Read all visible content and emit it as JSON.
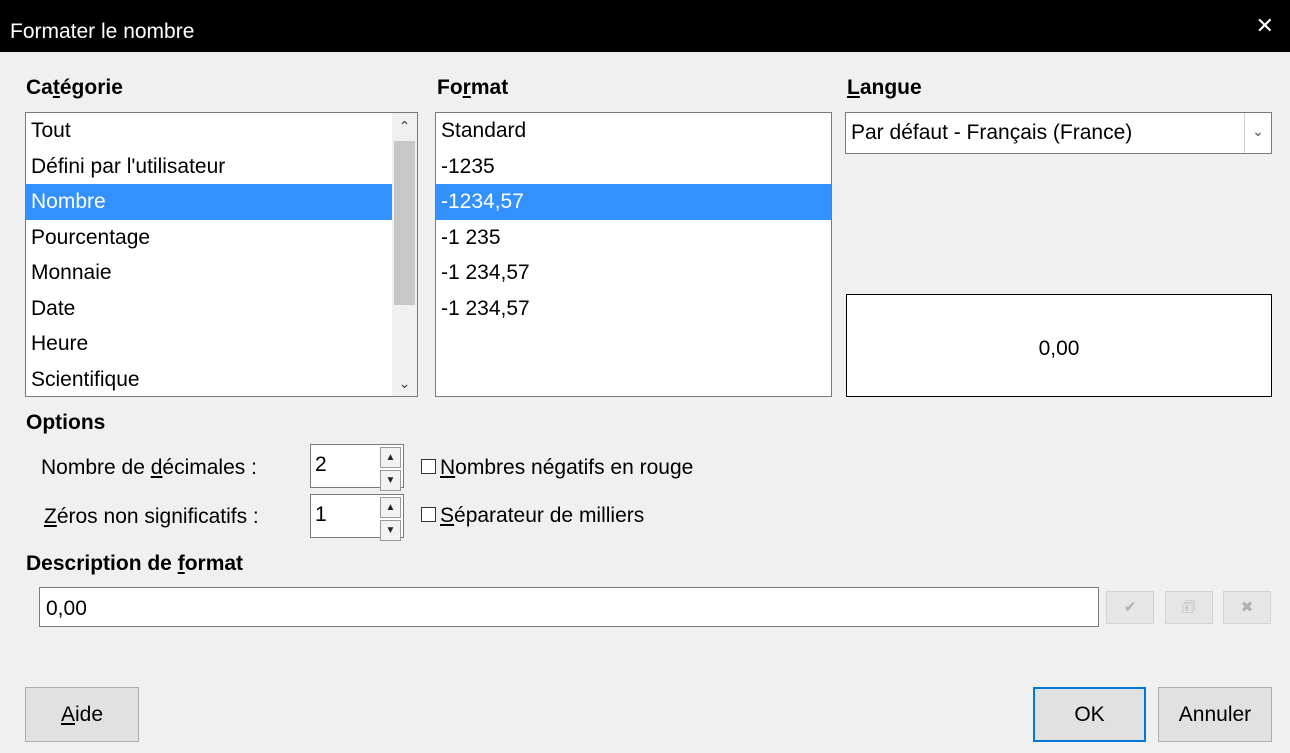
{
  "dialog": {
    "title": "Formater le nombre",
    "close_glyph": "✕"
  },
  "category": {
    "label_pre": "Ca",
    "label_acc": "t",
    "label_post": "égorie",
    "items": [
      "Tout",
      "Défini par l'utilisateur",
      "Nombre",
      "Pourcentage",
      "Monnaie",
      "Date",
      "Heure",
      "Scientifique"
    ],
    "selected": "Nombre"
  },
  "format": {
    "label_pre": "Fo",
    "label_acc": "r",
    "label_post": "mat",
    "items": [
      "Standard",
      "-1235",
      "-1234,57",
      "-1 235",
      "-1 234,57",
      "-1 234,57"
    ],
    "selected": "-1234,57"
  },
  "langue": {
    "label_acc": "L",
    "label_post": "angue",
    "value": "Par défaut - Français (France)"
  },
  "preview": {
    "value": "0,00"
  },
  "options": {
    "heading": "Options",
    "decimals": {
      "label_pre": "Nombre de ",
      "label_acc": "d",
      "label_post": "écimales :",
      "value": "2"
    },
    "zeros": {
      "label_pre": "",
      "label_acc": "Z",
      "label_post": "éros non significatifs :",
      "value": "1"
    },
    "negative_red": {
      "label_acc": "N",
      "label_post": "ombres négatifs en rouge",
      "checked": false
    },
    "thousands": {
      "label_acc": "S",
      "label_post": "éparateur de milliers",
      "checked": false
    }
  },
  "description": {
    "label_pre": "Description de ",
    "label_acc": "f",
    "label_post": "ormat",
    "value": "0,00",
    "buttons": {
      "add_icon": "check-icon",
      "edit_icon": "edit-comment-icon",
      "delete_icon": "delete-icon"
    }
  },
  "buttons": {
    "help_acc": "A",
    "help_post": "ide",
    "ok": "OK",
    "cancel": "Annuler"
  },
  "colors": {
    "selection": "#3391ff",
    "default_button_border": "#0078d7"
  }
}
